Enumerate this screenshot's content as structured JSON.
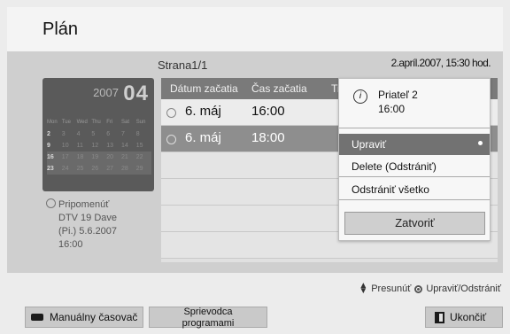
{
  "header": {
    "title": "Plán"
  },
  "page_info": "Strana1/1",
  "datetime": "2.apríl.2007, 15:30 hod.",
  "calendar": {
    "year": "2007",
    "month": "04",
    "weekdays": [
      "Mon",
      "Tue",
      "Wed",
      "Thu",
      "Fri",
      "Sat",
      "Sun"
    ],
    "weeks": [
      [
        "2",
        "3",
        "4",
        "5",
        "6",
        "7",
        "8"
      ],
      [
        "9",
        "10",
        "11",
        "12",
        "13",
        "14",
        "15"
      ],
      [
        "16",
        "17",
        "18",
        "19",
        "20",
        "21",
        "22"
      ],
      [
        "23",
        "24",
        "25",
        "26",
        "27",
        "28",
        "29"
      ]
    ]
  },
  "reminder": {
    "label": "Pripomenúť",
    "channel": "DTV 19 Dave",
    "date": "(Pi.) 5.6.2007",
    "time": "16:00"
  },
  "table": {
    "headers": {
      "date": "Dátum začatia",
      "time": "Čas začatia",
      "title": "Tit"
    },
    "rows": [
      {
        "date": "6. máj",
        "time": "16:00"
      },
      {
        "date": "6. máj",
        "time": "18:00"
      }
    ]
  },
  "popup": {
    "program_name": "Priateľ 2",
    "program_time": "16:00",
    "menu": [
      "Upraviť",
      "Delete (Odstrániť)",
      "Odstrániť všetko"
    ],
    "close_label": "Zatvoriť"
  },
  "help": {
    "move": "Presunúť",
    "edit_delete": "Upraviť/Odstrániť"
  },
  "footer": {
    "manual_timer": "Manuálny časovač",
    "guide_line1": "Sprievodca",
    "guide_line2": "programami",
    "exit": "Ukončiť"
  },
  "colors": {
    "highlight_row": "#8e8e8e",
    "menu_selected": "#727272",
    "header_bar": "#7a7a7a"
  }
}
